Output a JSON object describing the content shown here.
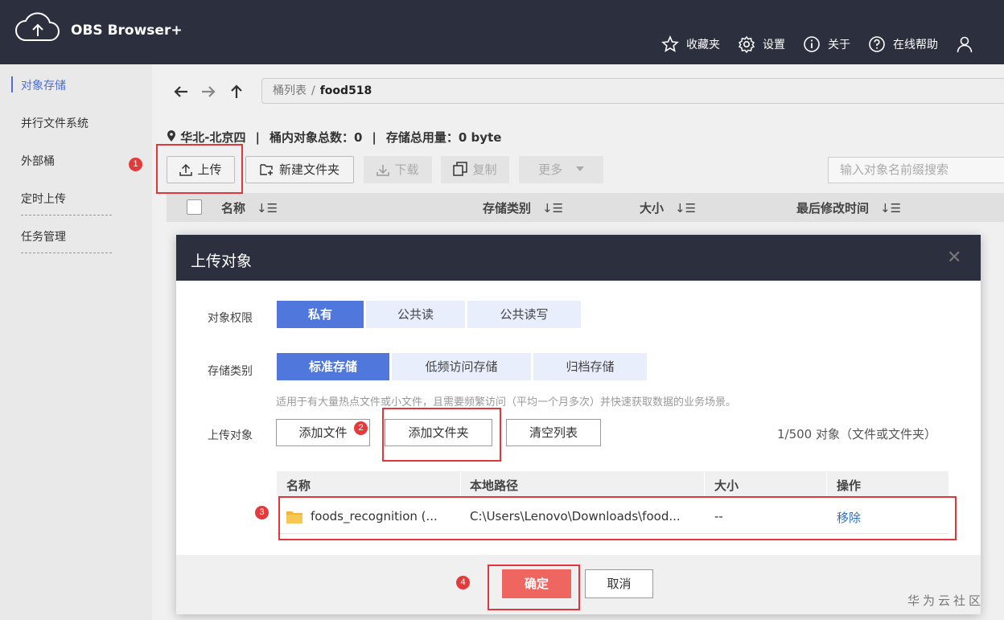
{
  "app": {
    "title": "OBS Browser+"
  },
  "topnav": {
    "favorites": "收藏夹",
    "settings": "设置",
    "about": "关于",
    "help": "在线帮助"
  },
  "sidebar": {
    "items": [
      {
        "label": "对象存储"
      },
      {
        "label": "并行文件系统"
      },
      {
        "label": "外部桶"
      },
      {
        "label": "定时上传"
      },
      {
        "label": "任务管理"
      }
    ]
  },
  "path": {
    "root": "桶列表",
    "separator": "/",
    "current": "food518"
  },
  "info": {
    "region": "华北-北京四",
    "separator": "|",
    "object_count": "桶内对象总数：0",
    "storage_used": "存储总用量：0 byte"
  },
  "toolbar": {
    "upload": "上传",
    "new_folder": "新建文件夹",
    "download": "下载",
    "copy": "复制",
    "more": "更多",
    "search_placeholder": "输入对象名前缀搜索"
  },
  "table": {
    "columns": [
      "名称",
      "存储类别",
      "大小",
      "最后修改时间"
    ]
  },
  "modal": {
    "title": "上传对象",
    "permission": {
      "label": "对象权限",
      "options": [
        "私有",
        "公共读",
        "公共读写"
      ],
      "selected": 0
    },
    "storage_class": {
      "label": "存储类别",
      "options": [
        "标准存储",
        "低频访问存储",
        "归档存储"
      ],
      "selected": 0
    },
    "hint": "适用于有大量热点文件或小文件，且需要频繁访问（平均一个月多次）并快速获取数据的业务场景。",
    "upload": {
      "label": "上传对象",
      "add_file": "添加文件",
      "add_folder": "添加文件夹",
      "clear_list": "清空列表",
      "count": "1/500 对象（文件或文件夹）"
    },
    "file_table": {
      "columns": [
        "名称",
        "本地路径",
        "大小",
        "操作"
      ],
      "rows": [
        {
          "name": "foods_recognition (...",
          "path": "C:\\Users\\Lenovo\\Downloads\\food...",
          "size": "--",
          "action": "移除"
        }
      ]
    },
    "ok": "确定",
    "cancel": "取消"
  },
  "badges": [
    "1",
    "2",
    "3",
    "4"
  ],
  "colors": {
    "primary": "#5078dc",
    "confirm": "#ef6661",
    "highlight": "#e0383a",
    "header": "#2c2f3e"
  },
  "watermark": "华为云社区"
}
